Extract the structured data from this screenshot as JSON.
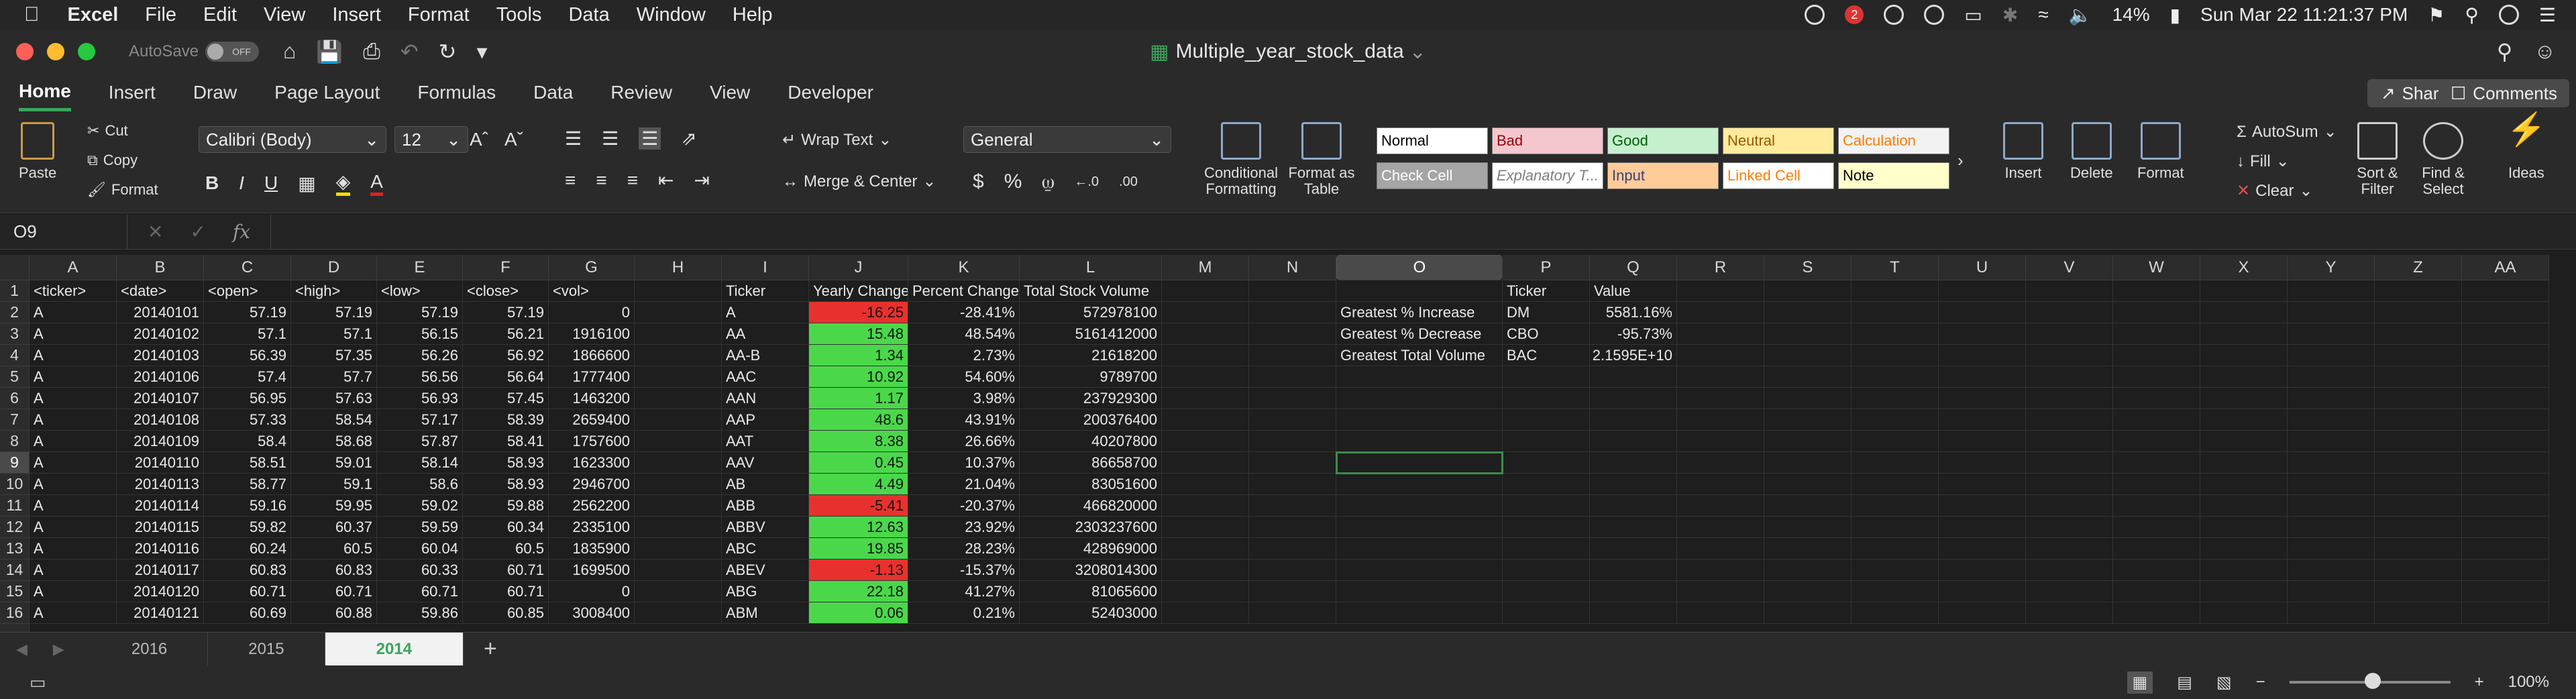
{
  "menubar": {
    "app": "Excel",
    "items": [
      "File",
      "Edit",
      "View",
      "Insert",
      "Format",
      "Tools",
      "Data",
      "Window",
      "Help"
    ],
    "notification_count": "2",
    "battery": "14%",
    "clock": "Sun Mar 22  11:21:37 PM"
  },
  "titlebar": {
    "autosave_label": "AutoSave",
    "autosave_state": "OFF",
    "doc_title": "Multiple_year_stock_data"
  },
  "ribbon_tabs": [
    "Home",
    "Insert",
    "Draw",
    "Page Layout",
    "Formulas",
    "Data",
    "Review",
    "View",
    "Developer"
  ],
  "share_label": "Share",
  "comments_label": "Comments",
  "ribbon": {
    "paste": "Paste",
    "cut": "Cut",
    "copy": "Copy",
    "format": "Format",
    "font_name": "Calibri (Body)",
    "font_size": "12",
    "wrap_text": "Wrap Text",
    "merge_center": "Merge & Center",
    "number_format": "General",
    "conditional_formatting": "Conditional Formatting",
    "format_as_table": "Format as Table",
    "styles": [
      {
        "label": "Normal",
        "bg": "#ffffff",
        "fg": "#000000"
      },
      {
        "label": "Bad",
        "bg": "#f4c7ce",
        "fg": "#9c0006"
      },
      {
        "label": "Good",
        "bg": "#c6efce",
        "fg": "#006100"
      },
      {
        "label": "Neutral",
        "bg": "#ffeb9c",
        "fg": "#9c5700"
      },
      {
        "label": "Calculation",
        "bg": "#f2f2f2",
        "fg": "#fa7d00"
      },
      {
        "label": "Check Cell",
        "bg": "#a5a5a5",
        "fg": "#ffffff"
      },
      {
        "label": "Explanatory T...",
        "bg": "#ffffff",
        "fg": "#7f7f7f"
      },
      {
        "label": "Input",
        "bg": "#ffcc99",
        "fg": "#3f3f76"
      },
      {
        "label": "Linked Cell",
        "bg": "#ffffff",
        "fg": "#fa7d00"
      },
      {
        "label": "Note",
        "bg": "#ffffcc",
        "fg": "#000000"
      }
    ],
    "insert": "Insert",
    "delete": "Delete",
    "format_cells": "Format",
    "autosum": "AutoSum",
    "fill": "Fill",
    "clear": "Clear",
    "sort_filter": "Sort & Filter",
    "find_select": "Find & Select",
    "ideas": "Ideas"
  },
  "formula_bar": {
    "name_box": "O9",
    "fx": "fx",
    "content": ""
  },
  "columns": [
    "A",
    "B",
    "C",
    "D",
    "E",
    "F",
    "G",
    "H",
    "I",
    "J",
    "K",
    "L",
    "M",
    "N",
    "O",
    "P",
    "Q",
    "R",
    "S",
    "T",
    "U",
    "V",
    "W",
    "X",
    "Y",
    "Z",
    "AA"
  ],
  "selected_column": "O",
  "selected_row": "9",
  "rows": [
    {
      "n": "1",
      "A": "<ticker>",
      "B": "<date>",
      "C": "<open>",
      "D": "<high>",
      "E": "<low>",
      "F": "<close>",
      "G": "<vol>",
      "I": "Ticker",
      "J": "Yearly Change",
      "K": "Percent Change",
      "L": "Total Stock Volume",
      "O": "",
      "P": "Ticker",
      "Q": "Value"
    },
    {
      "n": "2",
      "A": "A",
      "B": "20140101",
      "C": "57.19",
      "D": "57.19",
      "E": "57.19",
      "F": "57.19",
      "G": "0",
      "I": "A",
      "J": "-16.25",
      "K": "-28.41%",
      "L": "572978100",
      "O": "Greatest % Increase",
      "P": "DM",
      "Q": "5581.16%"
    },
    {
      "n": "3",
      "A": "A",
      "B": "20140102",
      "C": "57.1",
      "D": "57.1",
      "E": "56.15",
      "F": "56.21",
      "G": "1916100",
      "I": "AA",
      "J": "15.48",
      "K": "48.54%",
      "L": "5161412000",
      "O": "Greatest % Decrease",
      "P": "CBO",
      "Q": "-95.73%"
    },
    {
      "n": "4",
      "A": "A",
      "B": "20140103",
      "C": "56.39",
      "D": "57.35",
      "E": "56.26",
      "F": "56.92",
      "G": "1866600",
      "I": "AA-B",
      "J": "1.34",
      "K": "2.73%",
      "L": "21618200",
      "O": "Greatest Total Volume",
      "P": "BAC",
      "Q": "2.1595E+10"
    },
    {
      "n": "5",
      "A": "A",
      "B": "20140106",
      "C": "57.4",
      "D": "57.7",
      "E": "56.56",
      "F": "56.64",
      "G": "1777400",
      "I": "AAC",
      "J": "10.92",
      "K": "54.60%",
      "L": "9789700"
    },
    {
      "n": "6",
      "A": "A",
      "B": "20140107",
      "C": "56.95",
      "D": "57.63",
      "E": "56.93",
      "F": "57.45",
      "G": "1463200",
      "I": "AAN",
      "J": "1.17",
      "K": "3.98%",
      "L": "237929300"
    },
    {
      "n": "7",
      "A": "A",
      "B": "20140108",
      "C": "57.33",
      "D": "58.54",
      "E": "57.17",
      "F": "58.39",
      "G": "2659400",
      "I": "AAP",
      "J": "48.6",
      "K": "43.91%",
      "L": "200376400"
    },
    {
      "n": "8",
      "A": "A",
      "B": "20140109",
      "C": "58.4",
      "D": "58.68",
      "E": "57.87",
      "F": "58.41",
      "G": "1757600",
      "I": "AAT",
      "J": "8.38",
      "K": "26.66%",
      "L": "40207800"
    },
    {
      "n": "9",
      "A": "A",
      "B": "20140110",
      "C": "58.51",
      "D": "59.01",
      "E": "58.14",
      "F": "58.93",
      "G": "1623300",
      "I": "AAV",
      "J": "0.45",
      "K": "10.37%",
      "L": "86658700"
    },
    {
      "n": "10",
      "A": "A",
      "B": "20140113",
      "C": "58.77",
      "D": "59.1",
      "E": "58.6",
      "F": "58.93",
      "G": "2946700",
      "I": "AB",
      "J": "4.49",
      "K": "21.04%",
      "L": "83051600"
    },
    {
      "n": "11",
      "A": "A",
      "B": "20140114",
      "C": "59.16",
      "D": "59.95",
      "E": "59.02",
      "F": "59.88",
      "G": "2562200",
      "I": "ABB",
      "J": "-5.41",
      "K": "-20.37%",
      "L": "466820000"
    },
    {
      "n": "12",
      "A": "A",
      "B": "20140115",
      "C": "59.82",
      "D": "60.37",
      "E": "59.59",
      "F": "60.34",
      "G": "2335100",
      "I": "ABBV",
      "J": "12.63",
      "K": "23.92%",
      "L": "2303237600"
    },
    {
      "n": "13",
      "A": "A",
      "B": "20140116",
      "C": "60.24",
      "D": "60.5",
      "E": "60.04",
      "F": "60.5",
      "G": "1835900",
      "I": "ABC",
      "J": "19.85",
      "K": "28.23%",
      "L": "428969000"
    },
    {
      "n": "14",
      "A": "A",
      "B": "20140117",
      "C": "60.83",
      "D": "60.83",
      "E": "60.33",
      "F": "60.71",
      "G": "1699500",
      "I": "ABEV",
      "J": "-1.13",
      "K": "-15.37%",
      "L": "3208014300"
    },
    {
      "n": "15",
      "A": "A",
      "B": "20140120",
      "C": "60.71",
      "D": "60.71",
      "E": "60.71",
      "F": "60.71",
      "G": "0",
      "I": "ABG",
      "J": "22.18",
      "K": "41.27%",
      "L": "81065600"
    },
    {
      "n": "16",
      "A": "A",
      "B": "20140121",
      "C": "60.69",
      "D": "60.88",
      "E": "59.86",
      "F": "60.85",
      "G": "3008400",
      "I": "ABM",
      "J": "0.06",
      "K": "0.21%",
      "L": "52403000"
    }
  ],
  "sheets": [
    "2016",
    "2015",
    "2014"
  ],
  "active_sheet": "2014",
  "zoom": "100%",
  "colors": {
    "positive": "#4ad84a",
    "negative": "#e8312f",
    "accent": "#3ba55d"
  }
}
